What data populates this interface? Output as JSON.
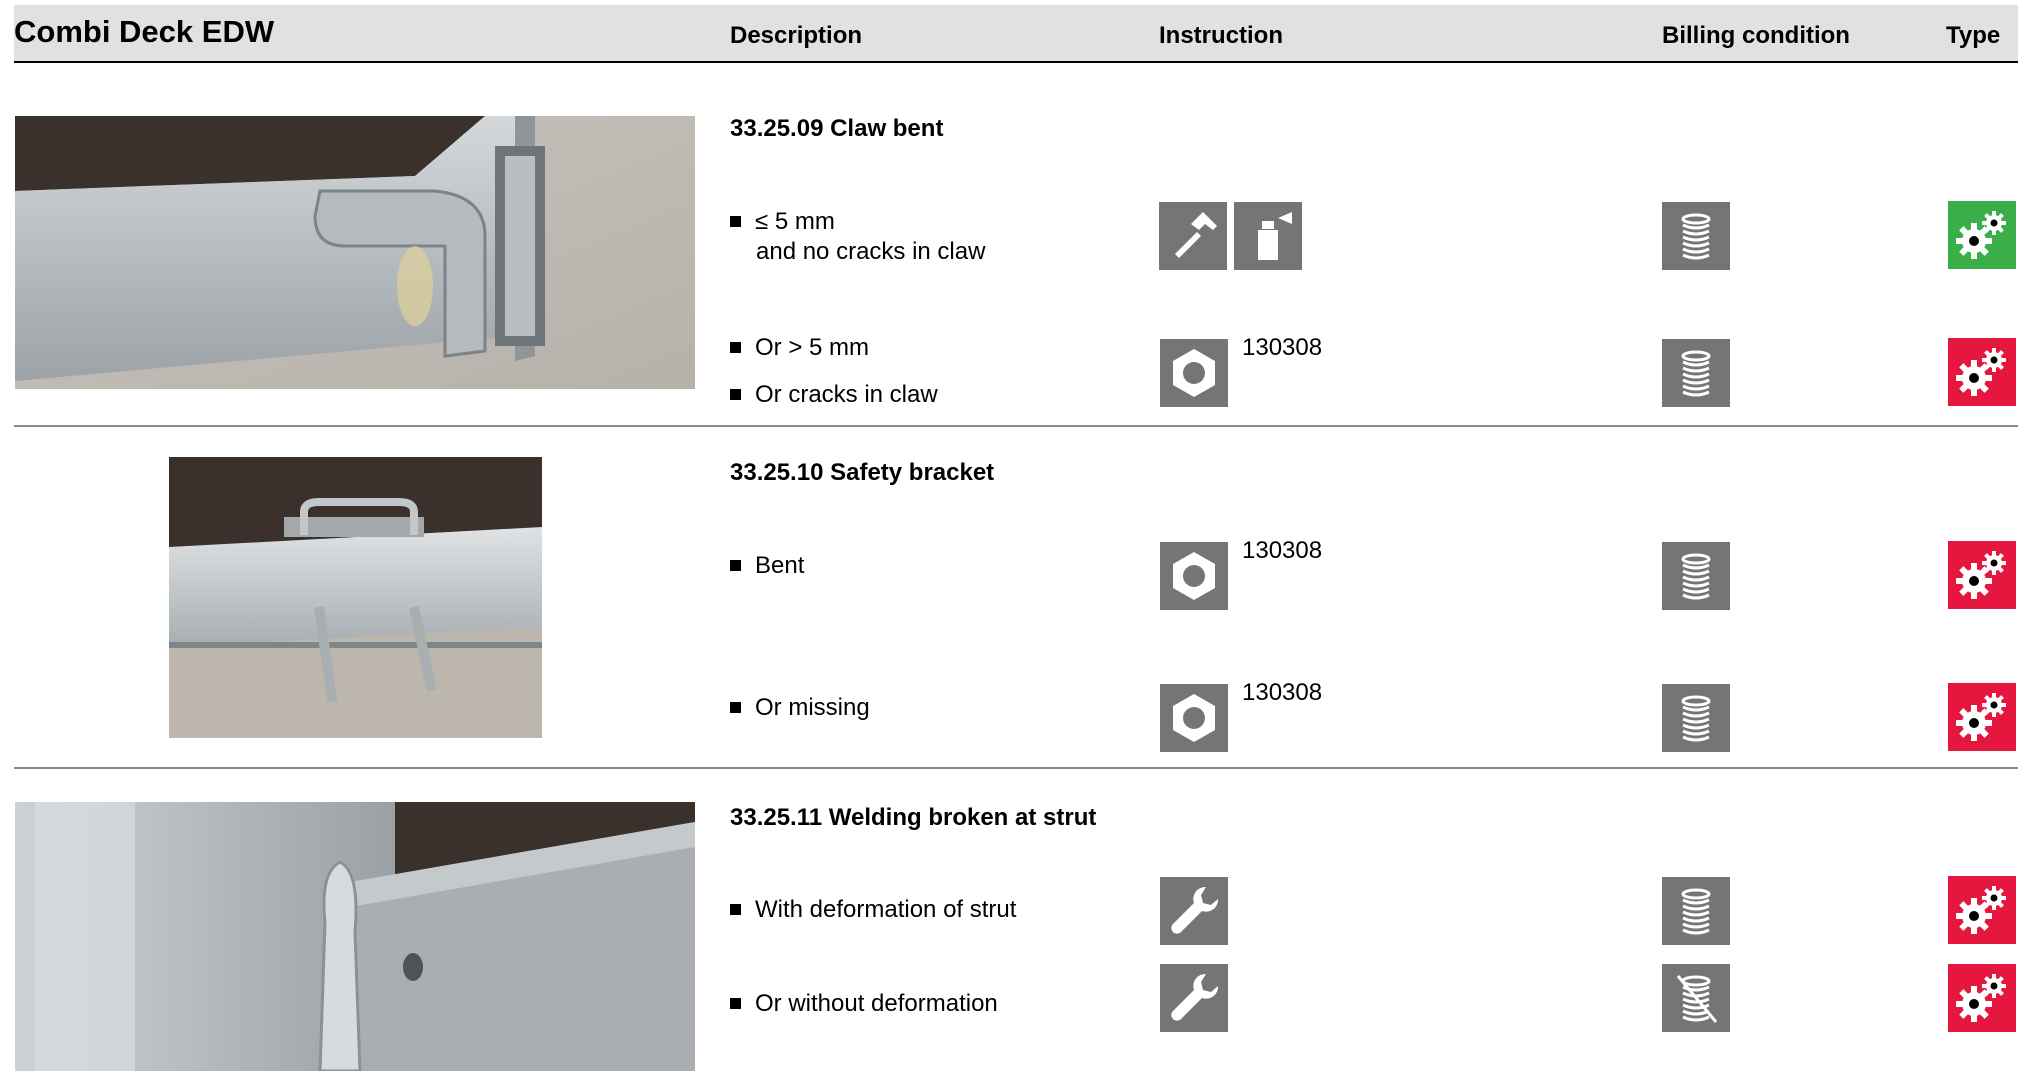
{
  "header": {
    "title": "Combi Deck EDW",
    "col_description": "Description",
    "col_instruction": "Instruction",
    "col_billing": "Billing condition",
    "col_type": "Type"
  },
  "colors": {
    "header_bg": "#e1e1e1",
    "icon_tile": "#757575",
    "type_green": "#3aae49",
    "type_red": "#e5173f"
  },
  "sections": [
    {
      "title": "33.25.09 Claw bent",
      "photo": "photo-claw-bent",
      "rows": [
        {
          "lines": [
            "≤ 5 mm",
            "and no cracks in claw"
          ],
          "instruction_icons": [
            "hammer-icon",
            "spray-can-icon"
          ],
          "part_number": "",
          "billing_icon": "coin-stack-icon",
          "type": "green-gears-icon"
        },
        {
          "lines": [
            "Or > 5 mm",
            "Or cracks in claw"
          ],
          "instruction_icons": [
            "replace-nut-icon"
          ],
          "part_number": "130308",
          "billing_icon": "coin-stack-icon",
          "type": "red-gears-icon"
        }
      ]
    },
    {
      "title": "33.25.10 Safety bracket",
      "photo": "photo-safety-bracket",
      "rows": [
        {
          "lines": [
            "Bent"
          ],
          "instruction_icons": [
            "replace-nut-icon"
          ],
          "part_number": "130308",
          "billing_icon": "coin-stack-icon",
          "type": "red-gears-icon"
        },
        {
          "lines": [
            "Or missing"
          ],
          "instruction_icons": [
            "replace-nut-icon"
          ],
          "part_number": "130308",
          "billing_icon": "coin-stack-icon",
          "type": "red-gears-icon"
        }
      ]
    },
    {
      "title": "33.25.11 Welding broken at strut",
      "photo": "photo-welding-strut",
      "rows": [
        {
          "lines": [
            "With deformation of strut"
          ],
          "instruction_icons": [
            "wrench-icon"
          ],
          "part_number": "",
          "billing_icon": "coin-stack-icon",
          "type": "red-gears-icon"
        },
        {
          "lines": [
            "Or without deformation"
          ],
          "instruction_icons": [
            "wrench-icon"
          ],
          "part_number": "",
          "billing_icon": "no-charge-coin-icon",
          "type": "red-gears-icon"
        }
      ]
    }
  ]
}
